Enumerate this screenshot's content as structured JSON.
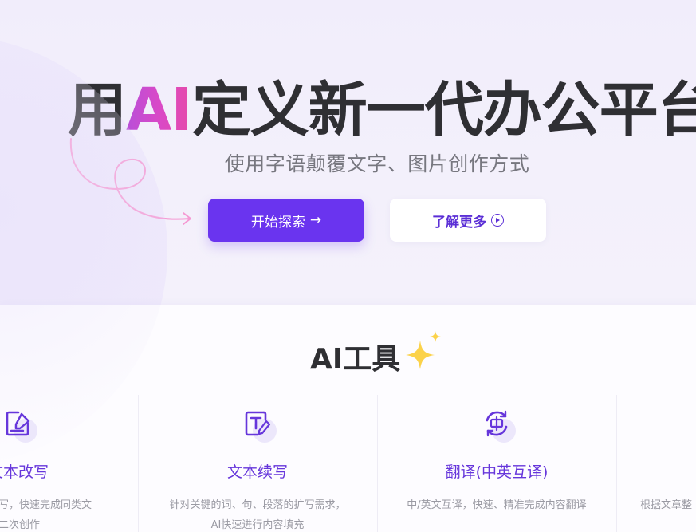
{
  "hero": {
    "title_before": "用",
    "title_highlight": "AI",
    "title_after": "定义新一代办公平台",
    "subtitle": "使用字语颠覆文字、图片创作方式",
    "primary_button": "开始探索",
    "primary_arrow": "→",
    "secondary_button": "了解更多"
  },
  "tools": {
    "title": "AI工具",
    "cards": [
      {
        "icon": "edit-document-icon",
        "name": "文本改写",
        "desc_line1": "改写，快速完成同类文",
        "desc_line2": "的二次创作"
      },
      {
        "icon": "text-pen-icon",
        "name": "文本续写",
        "desc_line1": "针对关键的词、句、段落的扩写需求，",
        "desc_line2": "AI快速进行内容填充"
      },
      {
        "icon": "translate-icon",
        "name": "翻译(中英互译)",
        "desc_line1": "中/英文互译，快速、精准完成内容翻译",
        "desc_line2": ""
      },
      {
        "icon": "",
        "name": "",
        "desc_line1": "根据文章整",
        "desc_line2": ""
      }
    ]
  },
  "colors": {
    "accent": "#6a34ef",
    "text_dark": "#2f2f33",
    "card_title": "#6636db",
    "highlight_gradient_start": "#b84fd9",
    "highlight_gradient_end": "#e64aa9"
  }
}
